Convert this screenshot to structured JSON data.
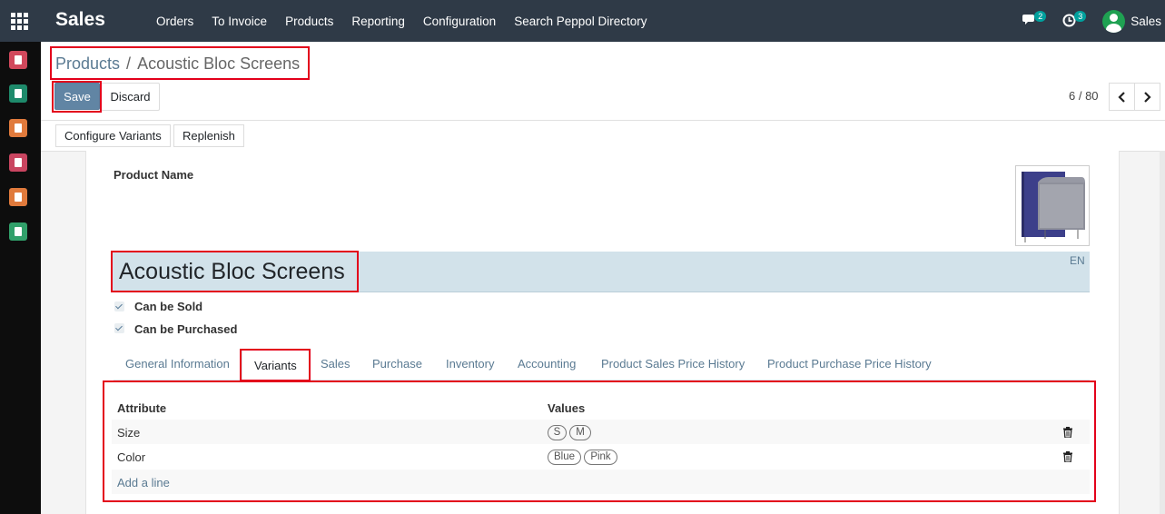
{
  "navbar": {
    "app_name": "Sales",
    "menu": [
      "Orders",
      "To Invoice",
      "Products",
      "Reporting",
      "Configuration",
      "Search Peppol Directory"
    ],
    "messages_count": "2",
    "activities_count": "3",
    "user_name": "Sales"
  },
  "appbar": {
    "items": [
      {
        "icon": "discuss-icon",
        "color": "#d1485c"
      },
      {
        "icon": "contacts-icon",
        "color": "#1e8a6b"
      },
      {
        "icon": "sales-icon",
        "color": "#e07a3c"
      },
      {
        "icon": "inventory-icon",
        "color": "#c94560"
      },
      {
        "icon": "invoicing-icon",
        "color": "#e07a3c"
      },
      {
        "icon": "documents-icon",
        "color": "#31a06a"
      }
    ]
  },
  "breadcrumb": {
    "parent": "Products",
    "separator": "/",
    "current": "Acoustic Bloc Screens"
  },
  "buttons": {
    "save": "Save",
    "discard": "Discard",
    "configure_variants": "Configure Variants",
    "replenish": "Replenish"
  },
  "pager": {
    "value": "6 / 80"
  },
  "form": {
    "product_name_label": "Product Name",
    "product_name": "Acoustic Bloc Screens",
    "lang": "EN",
    "can_be_sold_label": "Can be Sold",
    "can_be_sold": true,
    "can_be_purchased_label": "Can be Purchased",
    "can_be_purchased": true
  },
  "tabs": [
    "General Information",
    "Variants",
    "Sales",
    "Purchase",
    "Inventory",
    "Accounting",
    "Product Sales Price History",
    "Product Purchase Price History"
  ],
  "active_tab": "Variants",
  "variants": {
    "columns": [
      "Attribute",
      "Values"
    ],
    "rows": [
      {
        "attribute": "Size",
        "values": [
          "S",
          "M"
        ]
      },
      {
        "attribute": "Color",
        "values": [
          "Blue",
          "Pink"
        ]
      }
    ],
    "add_line": "Add a line"
  },
  "colors": {
    "navbar": "#2f3a47",
    "primary": "#6185a4",
    "link": "#5a7a92",
    "highlight": "#e3001b",
    "badge": "#00a09d"
  }
}
